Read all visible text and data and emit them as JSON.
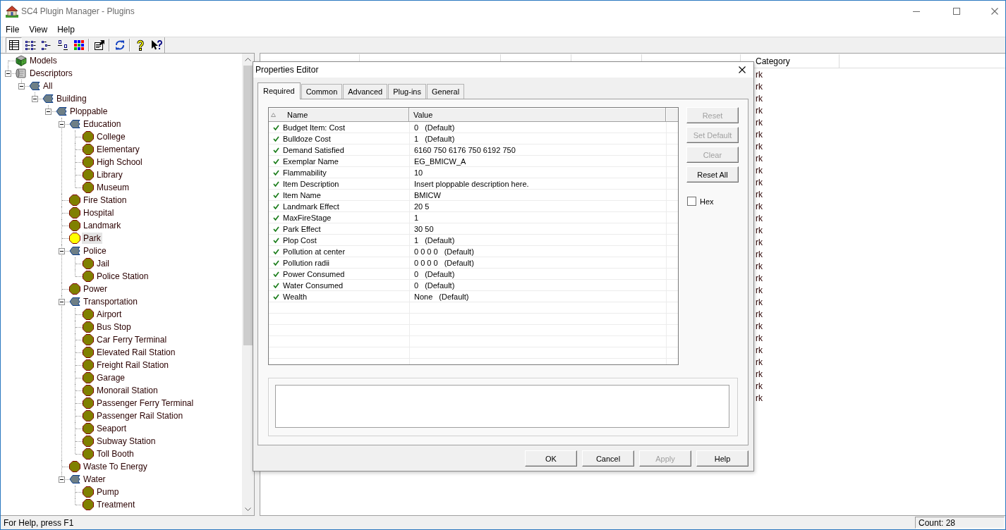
{
  "window": {
    "title": "SC4 Plugin Manager - Plugins"
  },
  "menu": [
    "File",
    "View",
    "Help"
  ],
  "toolbar": [
    {
      "kind": "details",
      "selected": true
    },
    {
      "kind": "list",
      "selected": false
    },
    {
      "kind": "outline",
      "selected": false
    },
    {
      "kind": "icons",
      "selected": false
    },
    {
      "kind": "colors",
      "selected": false
    },
    {
      "kind": "separator"
    },
    {
      "kind": "properties",
      "selected": false
    },
    {
      "kind": "separator"
    },
    {
      "kind": "refresh",
      "selected": false
    },
    {
      "kind": "separator"
    },
    {
      "kind": "help",
      "selected": false
    },
    {
      "kind": "whatsthis",
      "selected": false
    }
  ],
  "tree": [
    {
      "label": "Models",
      "kind": "model",
      "selected": false
    },
    {
      "label": "Descriptors",
      "kind": "descriptor",
      "expanded": true,
      "selected": false,
      "children": [
        {
          "label": "All",
          "kind": "group",
          "expanded": true,
          "selected": false,
          "children": [
            {
              "label": "Building",
              "kind": "group",
              "expanded": true,
              "selected": false,
              "children": [
                {
                  "label": "Ploppable",
                  "kind": "group",
                  "expanded": true,
                  "selected": false,
                  "children": [
                    {
                      "label": "Education",
                      "kind": "group",
                      "expanded": true,
                      "selected": false,
                      "children": [
                        {
                          "label": "College",
                          "kind": "item",
                          "selected": false
                        },
                        {
                          "label": "Elementary",
                          "kind": "item",
                          "selected": false
                        },
                        {
                          "label": "High School",
                          "kind": "item",
                          "selected": false
                        },
                        {
                          "label": "Library",
                          "kind": "item",
                          "selected": false
                        },
                        {
                          "label": "Museum",
                          "kind": "item",
                          "selected": false
                        }
                      ]
                    },
                    {
                      "label": "Fire Station",
                      "kind": "item",
                      "selected": false
                    },
                    {
                      "label": "Hospital",
                      "kind": "item",
                      "selected": false
                    },
                    {
                      "label": "Landmark",
                      "kind": "item",
                      "selected": false
                    },
                    {
                      "label": "Park",
                      "kind": "item",
                      "selected": true
                    },
                    {
                      "label": "Police",
                      "kind": "group",
                      "expanded": true,
                      "selected": false,
                      "children": [
                        {
                          "label": "Jail",
                          "kind": "item",
                          "selected": false
                        },
                        {
                          "label": "Police Station",
                          "kind": "item",
                          "selected": false
                        }
                      ]
                    },
                    {
                      "label": "Power",
                      "kind": "item",
                      "selected": false
                    },
                    {
                      "label": "Transportation",
                      "kind": "group",
                      "expanded": true,
                      "selected": false,
                      "children": [
                        {
                          "label": "Airport",
                          "kind": "item",
                          "selected": false
                        },
                        {
                          "label": "Bus Stop",
                          "kind": "item",
                          "selected": false
                        },
                        {
                          "label": "Car Ferry Terminal",
                          "kind": "item",
                          "selected": false
                        },
                        {
                          "label": "Elevated Rail Station",
                          "kind": "item",
                          "selected": false
                        },
                        {
                          "label": "Freight Rail Station",
                          "kind": "item",
                          "selected": false
                        },
                        {
                          "label": "Garage",
                          "kind": "item",
                          "selected": false
                        },
                        {
                          "label": "Monorail Station",
                          "kind": "item",
                          "selected": false
                        },
                        {
                          "label": "Passenger Ferry Terminal",
                          "kind": "item",
                          "selected": false
                        },
                        {
                          "label": "Passenger Rail Station",
                          "kind": "item",
                          "selected": false
                        },
                        {
                          "label": "Seaport",
                          "kind": "item",
                          "selected": false
                        },
                        {
                          "label": "Subway Station",
                          "kind": "item",
                          "selected": false
                        },
                        {
                          "label": "Toll Booth",
                          "kind": "item",
                          "selected": false
                        }
                      ]
                    },
                    {
                      "label": "Waste To Energy",
                      "kind": "item",
                      "selected": false
                    },
                    {
                      "label": "Water",
                      "kind": "group",
                      "expanded": true,
                      "selected": false,
                      "children": [
                        {
                          "label": "Pump",
                          "kind": "item",
                          "selected": false
                        },
                        {
                          "label": "Treatment",
                          "kind": "item",
                          "selected": false
                        }
                      ]
                    }
                  ]
                }
              ]
            }
          ]
        }
      ]
    }
  ],
  "plugins_list": {
    "columns": [
      "Category"
    ],
    "rows": [
      {
        "category": "rk"
      },
      {
        "category": "rk"
      },
      {
        "category": "rk"
      },
      {
        "category": "rk"
      },
      {
        "category": "rk"
      },
      {
        "category": "rk"
      },
      {
        "category": "rk"
      },
      {
        "category": "rk"
      },
      {
        "category": "rk"
      },
      {
        "category": "rk"
      },
      {
        "category": "rk"
      },
      {
        "category": "rk"
      },
      {
        "category": "rk"
      },
      {
        "category": "rk"
      },
      {
        "category": "rk"
      },
      {
        "category": "rk"
      },
      {
        "category": "rk"
      },
      {
        "category": "rk"
      },
      {
        "category": "rk"
      },
      {
        "category": "rk"
      },
      {
        "category": "rk"
      },
      {
        "category": "rk"
      },
      {
        "category": "rk"
      },
      {
        "category": "rk"
      },
      {
        "category": "rk"
      },
      {
        "category": "rk"
      },
      {
        "category": "rk"
      },
      {
        "category": "rk"
      }
    ]
  },
  "dialog": {
    "title": "Properties Editor",
    "tabs": [
      {
        "label": "Required",
        "selected": true
      },
      {
        "label": "Common",
        "selected": false
      },
      {
        "label": "Advanced",
        "selected": false
      },
      {
        "label": "Plug-ins",
        "selected": false
      },
      {
        "label": "General",
        "selected": false
      }
    ],
    "properties": {
      "columns": [
        "Name",
        "Value"
      ],
      "rows": [
        {
          "name": "Budget Item: Cost",
          "value": "0",
          "note": "(Default)",
          "checked": true
        },
        {
          "name": "Bulldoze Cost",
          "value": "1",
          "note": "(Default)",
          "checked": true
        },
        {
          "name": "Demand Satisfied",
          "value": "6160 750 6176 750 6192 750",
          "checked": true
        },
        {
          "name": "Exemplar Name",
          "value": "EG_BMICW_A",
          "checked": true
        },
        {
          "name": "Flammability",
          "value": "10",
          "checked": true
        },
        {
          "name": "Item Description",
          "value": "Insert ploppable description here.",
          "checked": true
        },
        {
          "name": "Item Name",
          "value": "BMICW",
          "checked": true
        },
        {
          "name": "Landmark Effect",
          "value": "20 5",
          "checked": true
        },
        {
          "name": "MaxFireStage",
          "value": "1",
          "checked": true
        },
        {
          "name": "Park Effect",
          "value": "30 50",
          "checked": true
        },
        {
          "name": "Plop Cost",
          "value": "1",
          "note": "(Default)",
          "checked": true
        },
        {
          "name": "Pollution at center",
          "value": "0 0 0 0",
          "note": "(Default)",
          "checked": true
        },
        {
          "name": "Pollution radii",
          "value": "0 0 0 0",
          "note": "(Default)",
          "checked": true
        },
        {
          "name": "Power Consumed",
          "value": "0",
          "note": "(Default)",
          "checked": true
        },
        {
          "name": "Water Consumed",
          "value": "0",
          "note": "(Default)",
          "checked": true
        },
        {
          "name": "Wealth",
          "value": "None",
          "note": "(Default)",
          "checked": true
        }
      ]
    },
    "side_buttons": [
      {
        "label": "Reset",
        "disabled": true
      },
      {
        "label": "Set Default",
        "disabled": true
      },
      {
        "label": "Clear",
        "disabled": true
      },
      {
        "label": "Reset All",
        "disabled": false
      }
    ],
    "hex": {
      "label": "Hex",
      "checked": false
    },
    "buttons": [
      {
        "label": "OK",
        "disabled": false
      },
      {
        "label": "Cancel",
        "disabled": false
      },
      {
        "label": "Apply",
        "disabled": true
      },
      {
        "label": "Help",
        "disabled": false
      }
    ]
  },
  "status_bar": {
    "text": "For Help, press F1",
    "count": "Count: 28"
  }
}
